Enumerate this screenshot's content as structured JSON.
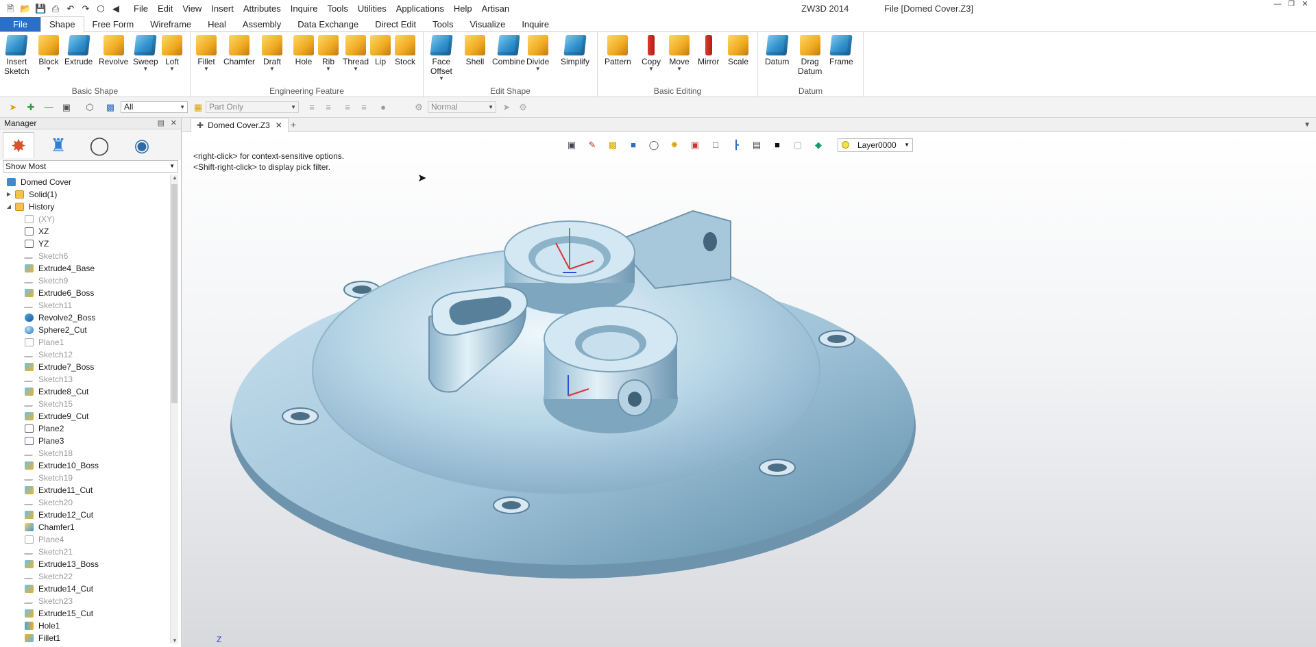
{
  "window": {
    "app_title": "ZW3D 2014",
    "file_title": "File [Domed Cover.Z3]"
  },
  "quick_access": [
    "new-icon",
    "open-icon",
    "save-icon",
    "print-icon",
    "undo-icon",
    "redo-icon",
    "view-icon",
    "back-arrow-icon"
  ],
  "menu": [
    "File",
    "Edit",
    "View",
    "Insert",
    "Attributes",
    "Inquire",
    "Tools",
    "Utilities",
    "Applications",
    "Help",
    "Artisan"
  ],
  "ribbon_tabs": {
    "file": "File",
    "tabs": [
      "Shape",
      "Free Form",
      "Wireframe",
      "Heal",
      "Assembly",
      "Data Exchange",
      "Direct Edit",
      "Tools",
      "Visualize",
      "Inquire"
    ],
    "active": "Shape"
  },
  "ribbon": {
    "groups": [
      {
        "label": "Basic Shape",
        "buttons": [
          {
            "label": "Insert",
            "label2": "Sketch",
            "icon": "insert-sketch-icon"
          },
          {
            "label": "Block",
            "icon": "block-icon",
            "dropdown": true
          },
          {
            "label": "Extrude",
            "icon": "extrude-icon"
          },
          {
            "label": "Revolve",
            "icon": "revolve-icon"
          },
          {
            "label": "Sweep",
            "icon": "sweep-icon",
            "dropdown": true
          },
          {
            "label": "Loft",
            "icon": "loft-icon",
            "dropdown": true
          }
        ]
      },
      {
        "label": "Engineering Feature",
        "buttons": [
          {
            "label": "Fillet",
            "icon": "fillet-icon",
            "dropdown": true
          },
          {
            "label": "Chamfer",
            "icon": "chamfer-icon"
          },
          {
            "label": "Draft",
            "icon": "draft-icon",
            "dropdown": true
          },
          {
            "label": "Hole",
            "icon": "hole-icon"
          },
          {
            "label": "Rib",
            "icon": "rib-icon",
            "dropdown": true
          },
          {
            "label": "Thread",
            "icon": "thread-icon",
            "dropdown": true
          },
          {
            "label": "Lip",
            "icon": "lip-icon"
          },
          {
            "label": "Stock",
            "icon": "stock-icon"
          }
        ]
      },
      {
        "label": "Edit Shape",
        "buttons": [
          {
            "label": "Face",
            "label2": "Offset",
            "icon": "face-offset-icon",
            "dropdown": true
          },
          {
            "label": "Shell",
            "icon": "shell-icon"
          },
          {
            "label": "Combine",
            "icon": "combine-icon"
          },
          {
            "label": "Divide",
            "icon": "divide-icon",
            "dropdown": true
          },
          {
            "label": "Simplify",
            "icon": "simplify-icon"
          }
        ]
      },
      {
        "label": "Basic Editing",
        "buttons": [
          {
            "label": "Pattern",
            "icon": "pattern-icon"
          },
          {
            "label": "Copy",
            "icon": "copy-icon",
            "dropdown": true
          },
          {
            "label": "Move",
            "icon": "move-icon",
            "dropdown": true
          },
          {
            "label": "Mirror",
            "icon": "mirror-icon"
          },
          {
            "label": "Scale",
            "icon": "scale-icon"
          }
        ]
      },
      {
        "label": "Datum",
        "buttons": [
          {
            "label": "Datum",
            "icon": "datum-icon"
          },
          {
            "label": "Drag",
            "label2": "Datum",
            "icon": "drag-datum-icon"
          },
          {
            "label": "Frame",
            "icon": "frame-icon"
          }
        ]
      }
    ]
  },
  "toolbar": {
    "filter_value": "All",
    "part_value": "Part Only",
    "mode_value": "Normal"
  },
  "manager": {
    "title": "Manager",
    "tabs": [
      "history-tab-icon",
      "assembly-tab-icon",
      "view-tab-icon",
      "render-tab-icon"
    ],
    "filter_value": "Show Most",
    "tree": [
      {
        "label": "Domed Cover",
        "level": 0,
        "icon": "root",
        "dim": false
      },
      {
        "label": "Solid(1)",
        "level": 1,
        "icon": "folder",
        "twisty": "▶",
        "dim": false
      },
      {
        "label": "History",
        "level": 1,
        "icon": "folder",
        "twisty": "◢",
        "dim": false
      },
      {
        "label": "(XY)",
        "level": 2,
        "icon": "plane",
        "dim": true
      },
      {
        "label": "XZ",
        "level": 2,
        "icon": "plane",
        "dim": false
      },
      {
        "label": "YZ",
        "level": 2,
        "icon": "plane",
        "dim": false
      },
      {
        "label": "Sketch6",
        "level": 2,
        "icon": "sketch",
        "dim": true
      },
      {
        "label": "Extrude4_Base",
        "level": 2,
        "icon": "ext",
        "dim": false
      },
      {
        "label": "Sketch9",
        "level": 2,
        "icon": "sketch",
        "dim": true
      },
      {
        "label": "Extrude6_Boss",
        "level": 2,
        "icon": "ext",
        "dim": false
      },
      {
        "label": "Sketch11",
        "level": 2,
        "icon": "sketch",
        "dim": true
      },
      {
        "label": "Revolve2_Boss",
        "level": 2,
        "icon": "rev",
        "dim": false
      },
      {
        "label": "Sphere2_Cut",
        "level": 2,
        "icon": "sph",
        "dim": false
      },
      {
        "label": "Plane1",
        "level": 2,
        "icon": "plane",
        "dim": true
      },
      {
        "label": "Sketch12",
        "level": 2,
        "icon": "sketch",
        "dim": true
      },
      {
        "label": "Extrude7_Boss",
        "level": 2,
        "icon": "ext",
        "dim": false
      },
      {
        "label": "Sketch13",
        "level": 2,
        "icon": "sketch",
        "dim": true
      },
      {
        "label": "Extrude8_Cut",
        "level": 2,
        "icon": "ext",
        "dim": false
      },
      {
        "label": "Sketch15",
        "level": 2,
        "icon": "sketch",
        "dim": true
      },
      {
        "label": "Extrude9_Cut",
        "level": 2,
        "icon": "ext",
        "dim": false
      },
      {
        "label": "Plane2",
        "level": 2,
        "icon": "plane",
        "dim": false
      },
      {
        "label": "Plane3",
        "level": 2,
        "icon": "plane",
        "dim": false
      },
      {
        "label": "Sketch18",
        "level": 2,
        "icon": "sketch",
        "dim": true
      },
      {
        "label": "Extrude10_Boss",
        "level": 2,
        "icon": "ext",
        "dim": false
      },
      {
        "label": "Sketch19",
        "level": 2,
        "icon": "sketch",
        "dim": true
      },
      {
        "label": "Extrude11_Cut",
        "level": 2,
        "icon": "ext",
        "dim": false
      },
      {
        "label": "Sketch20",
        "level": 2,
        "icon": "sketch",
        "dim": true
      },
      {
        "label": "Extrude12_Cut",
        "level": 2,
        "icon": "ext",
        "dim": false
      },
      {
        "label": "Chamfer1",
        "level": 2,
        "icon": "cham",
        "dim": false
      },
      {
        "label": "Plane4",
        "level": 2,
        "icon": "plane",
        "dim": true
      },
      {
        "label": "Sketch21",
        "level": 2,
        "icon": "sketch",
        "dim": true
      },
      {
        "label": "Extrude13_Boss",
        "level": 2,
        "icon": "ext",
        "dim": false
      },
      {
        "label": "Sketch22",
        "level": 2,
        "icon": "sketch",
        "dim": true
      },
      {
        "label": "Extrude14_Cut",
        "level": 2,
        "icon": "ext",
        "dim": false
      },
      {
        "label": "Sketch23",
        "level": 2,
        "icon": "sketch",
        "dim": true
      },
      {
        "label": "Extrude15_Cut",
        "level": 2,
        "icon": "ext",
        "dim": false
      },
      {
        "label": "Hole1",
        "level": 2,
        "icon": "hole",
        "dim": false
      },
      {
        "label": "Fillet1",
        "level": 2,
        "icon": "fil",
        "dim": false
      }
    ]
  },
  "document": {
    "tab_label": "Domed Cover.Z3"
  },
  "viewport": {
    "hint_1": "<right-click> for context-sensitive options.",
    "hint_2": "<Shift-right-click> to display pick filter.",
    "layer_value": "Layer0000",
    "axis_label": "Z",
    "model_color": "#a9cbe0"
  }
}
